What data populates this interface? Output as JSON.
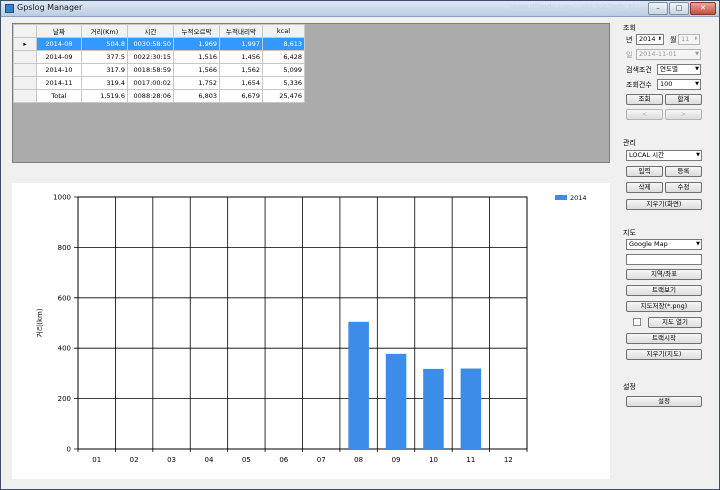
{
  "window": {
    "title": "Gpslog Manager",
    "url_fragment": "www.dilandu.com/...plo_top?mfo_kio..."
  },
  "grid": {
    "columns": [
      "날짜",
      "거리(Km)",
      "시간",
      "누적오르막",
      "누적내리막",
      "kcal"
    ],
    "rows": [
      {
        "cells": [
          "2014-08",
          "504.8",
          "0030:58:50",
          "1,969",
          "1,997",
          "8,613"
        ],
        "selected": true
      },
      {
        "cells": [
          "2014-09",
          "377.5",
          "0022:30:15",
          "1,516",
          "1,456",
          "6,428"
        ],
        "selected": false
      },
      {
        "cells": [
          "2014-10",
          "317.9",
          "0018:58:59",
          "1,566",
          "1,562",
          "5,099"
        ],
        "selected": false
      },
      {
        "cells": [
          "2014-11",
          "319.4",
          "0017:00:02",
          "1,752",
          "1,654",
          "5,336"
        ],
        "selected": false
      },
      {
        "cells": [
          "Total",
          "1,519.6",
          "0088:28:06",
          "6,803",
          "6,679",
          "25,476"
        ],
        "selected": false
      }
    ]
  },
  "chart_data": {
    "type": "bar",
    "categories": [
      "01",
      "02",
      "03",
      "04",
      "05",
      "06",
      "07",
      "08",
      "09",
      "10",
      "11",
      "12"
    ],
    "series": [
      {
        "name": "2014",
        "values": [
          0,
          0,
          0,
          0,
          0,
          0,
          0,
          504.8,
          377.5,
          317.9,
          319.4,
          0
        ],
        "color": "#3b8de8"
      }
    ],
    "ylabel": "거리(km)",
    "ylim": [
      0,
      1000
    ],
    "yticks": [
      0,
      200,
      400,
      600,
      800,
      1000
    ],
    "grid": true,
    "legend": "top-right"
  },
  "query": {
    "title": "조회",
    "year_label": "년",
    "year_value": "2014",
    "month_label": "월",
    "month_value": "11",
    "day_label": "일",
    "day_value": "2014-11-01",
    "condition_label": "검색조건",
    "condition_value": "연도별",
    "count_label": "조회건수",
    "count_value": "100",
    "search_btn": "조회",
    "sum_btn": "합계",
    "prev_btn": "<",
    "next_btn": ">"
  },
  "manage": {
    "title": "관리",
    "time_value": "LOCAL 시간",
    "input_btn": "입력",
    "register_btn": "등록",
    "delete_btn": "삭제",
    "edit_btn": "수정",
    "clear_screen_btn": "지우기(화면)"
  },
  "map": {
    "title": "지도",
    "provider_value": "Google Map",
    "search_value": "",
    "region_btn": "지역/좌표",
    "track_view_btn": "트랙보기",
    "save_map_btn": "지도저장(*.png)",
    "open_map_btn": "지도 열기",
    "track_start_btn": "트랙시작",
    "clear_map_btn": "지우기(지도)"
  },
  "settings": {
    "title": "설정",
    "settings_btn": "설정"
  },
  "colors": {
    "selection": "#3399ff",
    "bar": "#3b8de8",
    "grid_bg": "#ababab"
  }
}
